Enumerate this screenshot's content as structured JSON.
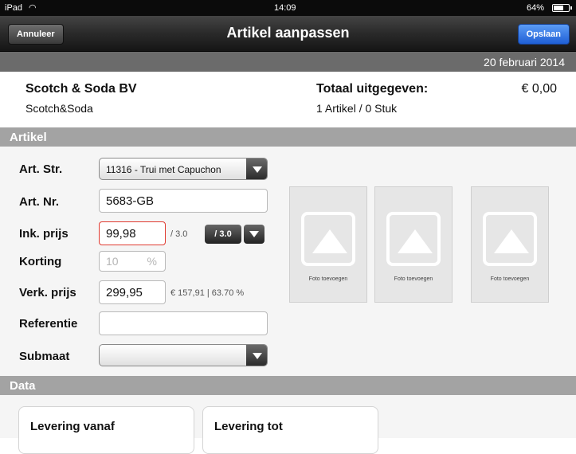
{
  "status_bar": {
    "device": "iPad",
    "time": "14:09",
    "battery": "64%",
    "battery_level": 0.64
  },
  "nav": {
    "cancel_label": "Annuleer",
    "title": "Artikel aanpassen",
    "save_label": "Opslaan"
  },
  "date_bar": {
    "date": "20 februari 2014"
  },
  "supplier": {
    "name": "Scotch & Soda BV",
    "sub": "Scotch&Soda"
  },
  "totals": {
    "label": "Totaal uitgegeven:",
    "value": "€ 0,00",
    "sub": "1 Artikel / 0 Stuk"
  },
  "sections": {
    "artikel": "Artikel",
    "data": "Data"
  },
  "form": {
    "art_str": {
      "label": "Art. Str.",
      "value": "11316 - Trui met Capuchon"
    },
    "art_nr": {
      "label": "Art. Nr.",
      "value": "5683-GB"
    },
    "ink_prijs": {
      "label": "Ink. prijs",
      "value": "99,98",
      "factor": "/ 3.0",
      "factor_button": "/ 3.0"
    },
    "korting": {
      "label": "Korting",
      "value": "10",
      "unit": "%"
    },
    "verk_prijs": {
      "label": "Verk. prijs",
      "value": "299,95",
      "margin": "€ 157,91 | 63.70 %"
    },
    "referentie": {
      "label": "Referentie",
      "value": ""
    },
    "submaat": {
      "label": "Submaat",
      "value": ""
    }
  },
  "photos": [
    {
      "caption": "Foto toevoegen"
    },
    {
      "caption": "Foto toevoegen"
    },
    {
      "caption": "Foto toevoegen"
    }
  ],
  "data_cards": {
    "from": "Levering vanaf",
    "to": "Levering tot"
  },
  "colors": {
    "nav_bg": "#2a2a2a",
    "save_button": "#2f6fe0",
    "section_bg": "#a3a3a3",
    "error_border": "#e0392f"
  }
}
